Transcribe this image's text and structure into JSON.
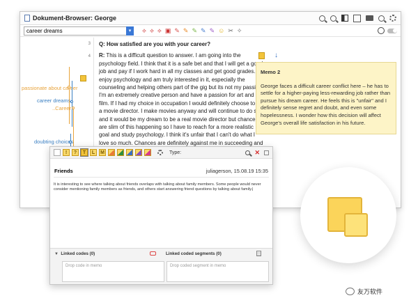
{
  "window": {
    "title": "Dokument-Browser: George"
  },
  "search": {
    "value": "career dreams"
  },
  "left_codes": [
    {
      "label": "passionate about career",
      "color": "#e8a33b"
    },
    {
      "label": "career dreams",
      "color": "#3a7fc2"
    },
    {
      "label": "..Career",
      "color": "#e8a33b"
    },
    {
      "label": "doubting choices",
      "color": "#3a7fc2"
    }
  ],
  "line_numbers": [
    "3",
    "4"
  ],
  "document": {
    "question": "Q: How satisfied are you with your career?",
    "answer_prefix": "R:",
    "answer": "This is a difficult question to answer. I am going into the psychology field. I think that it is a safe bet and that I will get a good job and pay if I work hard in all my classes and get good grades. I enjoy psychology and am truly interested in it, especially the counseling and helping others part of the gig but its not my passion. I'm an extremely creative person and have a passion for art and film. If I had my choice in occupation I would definitely choose to be a movie director. I make movies anyway and will continue to do so, and it would be my dream to be a real movie director but chances are slim of this happening so I have to reach for a more realistic goal and study psychology. I think it's unfair that I can't do what I love so much. Chances are definitely against me in succeeding and its not a good feeling to know that you may be stuck with a job that isn't that rewarding to you for the rest of"
  },
  "memo_panel": {
    "title": "Memo 2",
    "text": "George faces a difficult career conflict here – he has to settle for a higher-paying less-rewarding job rather than pursue his dream career. He feels this is \"unfair\" and I definitely sense regret and doubt, and even some hopelessness. I wonder how this decision will affect George's overall life satisfaction in his future."
  },
  "memo_editor": {
    "toolbar_icons": [
      "!",
      "?",
      "T",
      "L",
      "M"
    ],
    "type_label": "Type:",
    "title": "Friends",
    "meta": "juliagerson, 15.08.19 15:35",
    "body": "It is interesting to see where talking about friends overlaps with talking about family members. Some people would never consider mentioning family members as friends, and others start answering friend questions by talking about family.|",
    "linked_codes": "Linked codes (0)",
    "linked_segments": "Linked coded segments (0)",
    "drop_code": "Drop code in memo",
    "drop_segment": "Drop coded segment in memo"
  },
  "watermark": {
    "text": "友万软件"
  }
}
